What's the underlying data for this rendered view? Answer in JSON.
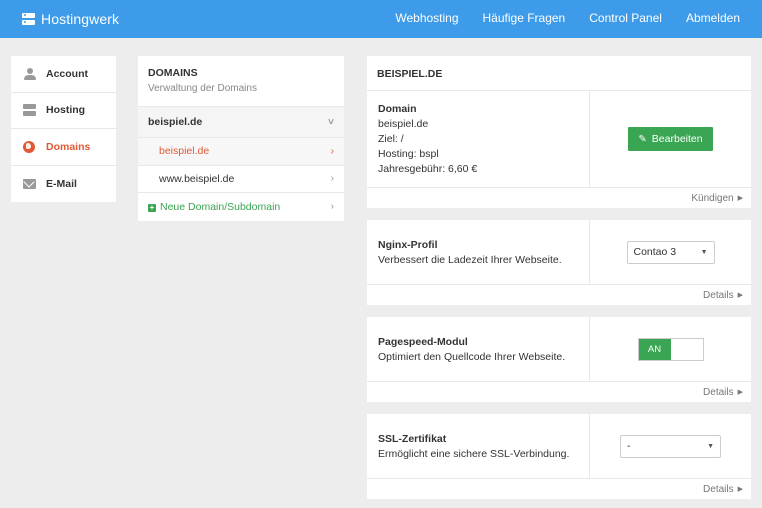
{
  "app": {
    "title": "Hostingwerk"
  },
  "nav": [
    "Webhosting",
    "Häufige Fragen",
    "Control Panel",
    "Abmelden"
  ],
  "sidebar": {
    "items": [
      {
        "label": "Account",
        "icon": "person-icon"
      },
      {
        "label": "Hosting",
        "icon": "server-icon"
      },
      {
        "label": "Domains",
        "icon": "globe-icon",
        "active": true
      },
      {
        "label": "E-Mail",
        "icon": "mail-icon"
      }
    ]
  },
  "domains": {
    "title": "DOMAINS",
    "subtitle": "Verwaltung der Domains",
    "group": {
      "label": "beispiel.de",
      "chevron": "˅"
    },
    "items": [
      {
        "label": "beispiel.de",
        "active": true
      },
      {
        "label": "www.beispiel.de"
      }
    ],
    "add_label": "Neue Domain/Subdomain",
    "chevron": "›"
  },
  "detail": {
    "title": "BEISPIEL.DE",
    "domain_card": {
      "heading": "Domain",
      "name": "beispiel.de",
      "ziel": "Ziel: /",
      "hosting": "Hosting: bspl",
      "fee": "Jahresgebühr: 6,60 €",
      "button": "Bearbeiten",
      "footer": "Kündigen"
    },
    "nginx_card": {
      "heading": "Nginx-Profil",
      "desc": "Verbessert die Ladezeit Ihrer Webseite.",
      "select_value": "Contao 3",
      "footer": "Details"
    },
    "pagespeed_card": {
      "heading": "Pagespeed-Modul",
      "desc": "Optimiert den Quellcode Ihrer Webseite.",
      "toggle_label": "AN",
      "footer": "Details"
    },
    "ssl_card": {
      "heading": "SSL-Zertifikat",
      "desc": "Ermöglicht eine sichere SSL-Verbindung.",
      "select_value": "-",
      "footer": "Details"
    }
  },
  "colors": {
    "topbar": "#3d9be9",
    "accent": "#e05a35",
    "green": "#3aa553",
    "background": "#ededed"
  }
}
